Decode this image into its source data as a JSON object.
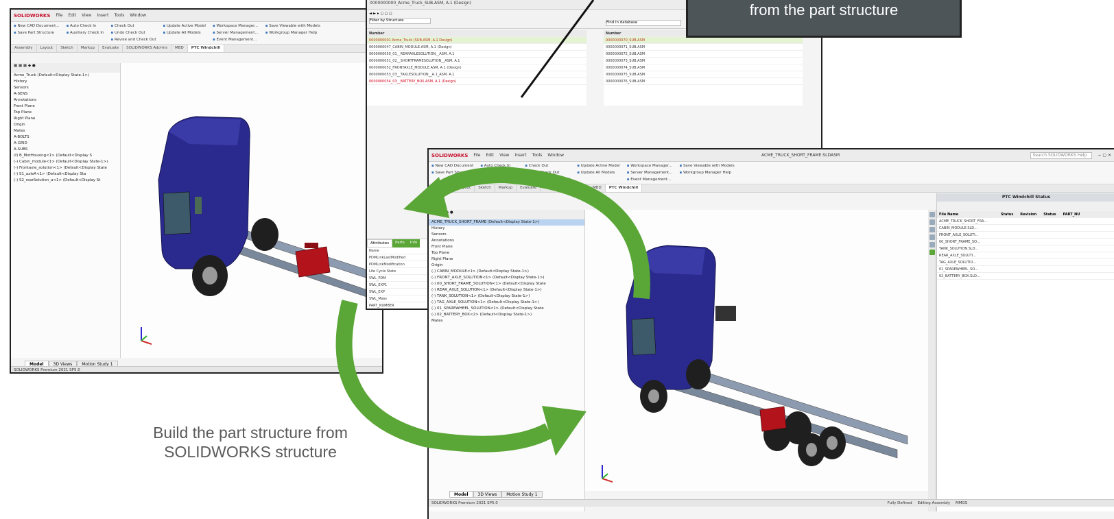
{
  "callout": {
    "text": "from the part structure"
  },
  "caption": {
    "line1": "Build the part structure from",
    "line2": "SOLIDWORKS structure"
  },
  "colors": {
    "arrow_green": "#5aa636",
    "truck_blue": "#2a2a8e",
    "battery_red": "#b3141b",
    "callout_bg": "#4d5559"
  },
  "window1": {
    "title_app": "SOLIDWORKS",
    "menu": [
      "File",
      "Edit",
      "View",
      "Insert",
      "Tools",
      "Window"
    ],
    "ribbon": [
      [
        "New CAD Document...",
        "Save Part Structure"
      ],
      [
        "Auto Check In",
        "Auxiliary Check In"
      ],
      [
        "Check Out",
        "Undo Check Out",
        "Revise and Check Out"
      ],
      [
        "Update Active Model",
        "Update All Models"
      ],
      [
        "Workspace Manager...",
        "Server Management...",
        "Event Management..."
      ],
      [
        "Save Viewable with Models",
        "Workgroup Manager Help"
      ]
    ],
    "tabs": [
      "Assembly",
      "Layout",
      "Sketch",
      "Markup",
      "Evaluate",
      "SOLIDWORKS Add-Ins",
      "MBD",
      "PTC Windchill"
    ],
    "tree": [
      "Acme_Truck (Default<Display State-1>)",
      "History",
      "Sensors",
      "A-SENS",
      "Annotations",
      "Front Plane",
      "Top Plane",
      "Right Plane",
      "Origin",
      "Mates",
      "A-BOLTS",
      "A-GRID",
      "A-SUBS",
      "(f) B_MotHousing<1> (Default<Display S",
      "(-) Cabin_module<1> (Default<Display State-1>)",
      "(-) Frontaxle_solution<1> (Default<Display State",
      "(-) S1_axleA<1> (Default<Display Sta",
      "(-) S2_rearSolution_a<1> (Default<Display St"
    ],
    "bottom_tabs": [
      "Model",
      "3D Views",
      "Motion Study 1"
    ],
    "status": "SOLIDWORKS Premium 2021 SP5.0"
  },
  "window2": {
    "title": "0000000000_Acme_Truck_SUB.ASM, A.1 (Design)",
    "left_filter": "Filter by Structure",
    "right_filter": "Find in database",
    "left_header": "Number",
    "right_header": "Number",
    "left_rows": [
      "0000000001 Acme_Truck (SUB.ASM, A.1 Design)",
      "0000000047_CABIN_MODULE.ASM, A.1 (Design)",
      "0000000050_01__REARAXLESOLUTION__ASM, A.1",
      "0000000051_02__SHORTFRAMESOLUTION__ASM, A.1",
      "0000000052_FRONTAXLE_MODULE.ASM, A.1 (Design)",
      "0000000053_03__TAXLESOLUTION__A.1_ASM, A.1",
      "0000000054_03__BATTERY_BOX.ASM, A.1 (Design)"
    ],
    "right_rows": [
      "0000000070_SUB.ASM",
      "0000000071_SUB.ASM",
      "0000000072_SUB.ASM",
      "0000000073_SUB.ASM",
      "0000000074_SUB.ASM",
      "0000000075_SUB.ASM",
      "0000000076_SUB.ASM"
    ],
    "attributes_tabs": [
      "Attributes",
      "Parts",
      "Info"
    ],
    "attributes": [
      "Name",
      "PDMLinkLastModified",
      "PDMLinkModification",
      "Life Cycle State",
      "SWL_PDM",
      "SWL_EXP1",
      "SWL_EXP",
      "SWL_Mass",
      "PART_NUMBER"
    ]
  },
  "window3": {
    "title": "ACME_TRUCK_SHORT_FRAME.SLDASM",
    "search_placeholder": "Search SOLIDWORKS Help",
    "menu": [
      "File",
      "Edit",
      "View",
      "Insert",
      "Tools",
      "Window"
    ],
    "ribbon": [
      [
        "New CAD Document",
        "Save Part Structure"
      ],
      [
        "Auto Check In",
        "Auxiliary Check In"
      ],
      [
        "Check Out",
        "Undo Check Out",
        "Revise and Check Out"
      ],
      [
        "Update Active Model",
        "Update All Models"
      ],
      [
        "Workspace Manager...",
        "Server Management...",
        "Event Management..."
      ],
      [
        "Save Viewable with Models",
        "Workgroup Manager Help"
      ]
    ],
    "tabs": [
      "Assembly",
      "Layout",
      "Sketch",
      "Markup",
      "Evaluate",
      "SOLIDWORKS Add-Ins",
      "MBD",
      "PTC Windchill"
    ],
    "tree": [
      "ACME_TRUCK_SHORT_FRAME (Default<Display State-1>)",
      "History",
      "Sensors",
      "Annotations",
      "Front Plane",
      "Top Plane",
      "Right Plane",
      "Origin",
      "(-) CABIN_MODULE<1> (Default<Display State-1>)",
      "(-) FRONT_AXLE_SOLUTION<1> (Default<Display State-1>)",
      "(-) 00_SHORT_FRAME_SOLUTION<1> (Default<Display State",
      "(-) REAR_AXLE_SOLUTION<1> (Default<Display State-1>)",
      "(-) TANK_SOLUTION<1> (Default<Display State-1>)",
      "(-) TAG_AXLE_SOLUTION<1> (Default<Display State-1>)",
      "(-) 01_SPAREWHEEL_SOLUTION<1> (Default<Display State",
      "(-) 02_BATTERY_BOX<2> (Default<Display State-1>)",
      "Mates"
    ],
    "panel_title": "PTC Windchill Status",
    "panel_headers": [
      "File Name",
      "Status",
      "Revision",
      "Status",
      "PART_NU"
    ],
    "panel_rows": [
      "ACME_TRUCK_SHORT_FRA...",
      "CABIN_MODULE.SLD...",
      "FRONT_AXLE_SOLUTI...",
      "00_SHORT_FRAME_SO...",
      "TANK_SOLUTION.SLD...",
      "REAR_AXLE_SOLUTI...",
      "TAG_AXLE_SOLUTIO...",
      "01_SPAREWHEEL_SO...",
      "02_BATTERY_BOX.SLD..."
    ],
    "bottom_tabs": [
      "Model",
      "3D Views",
      "Motion Study 1"
    ],
    "status": "SOLIDWORKS Premium 2021 SP5.0",
    "status_right": [
      "Fully Defined",
      "Editing Assembly",
      "MMGS"
    ]
  }
}
